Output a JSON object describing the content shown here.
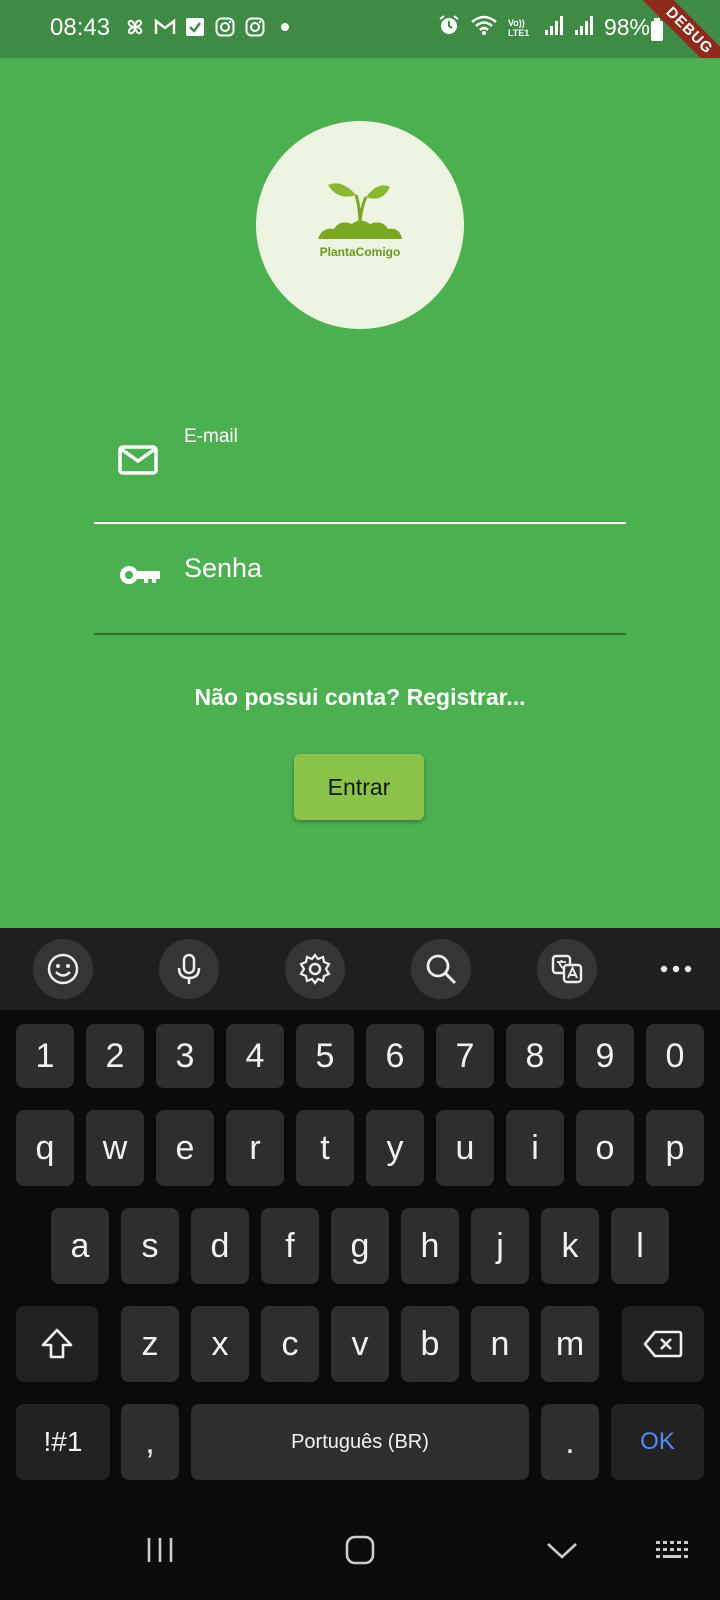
{
  "status_bar": {
    "time": "08:43",
    "battery": "98%",
    "debug_banner": "DEBUG",
    "left_icons": [
      "pinwheel-icon",
      "gmail-icon",
      "task-check-icon",
      "instagram-icon",
      "instagram-icon",
      "dot-icon"
    ],
    "right_icons": [
      "alarm-icon",
      "wifi-icon",
      "volte-icon",
      "signal-icon",
      "signal-icon",
      "battery-icon"
    ],
    "volte_label": "Vo)) LTE1"
  },
  "app": {
    "logo_text": "PlantaComigo",
    "email_label": "E-mail",
    "password_placeholder": "Senha",
    "register_link": "Não possui conta? Registrar...",
    "login_button": "Entrar",
    "colors": {
      "background": "#4caf50",
      "button": "#8bc34a",
      "logo_bg": "#edf4e1"
    }
  },
  "keyboard": {
    "toolbar": [
      "emoji-icon",
      "microphone-icon",
      "settings-icon",
      "search-icon",
      "translate-icon",
      "more-icon"
    ],
    "row_numbers": [
      "1",
      "2",
      "3",
      "4",
      "5",
      "6",
      "7",
      "8",
      "9",
      "0"
    ],
    "row_1": [
      "q",
      "w",
      "e",
      "r",
      "t",
      "y",
      "u",
      "i",
      "o",
      "p"
    ],
    "row_2": [
      "a",
      "s",
      "d",
      "f",
      "g",
      "h",
      "j",
      "k",
      "l"
    ],
    "row_3": [
      "z",
      "x",
      "c",
      "v",
      "b",
      "n",
      "m"
    ],
    "symbols_key": "!#1",
    "comma_key": ",",
    "space_label": "Português (BR)",
    "period_key": ".",
    "ok_key": "OK"
  },
  "nav_bar": [
    "recents-icon",
    "home-icon",
    "back-icon",
    "keyboard-hide-icon"
  ]
}
